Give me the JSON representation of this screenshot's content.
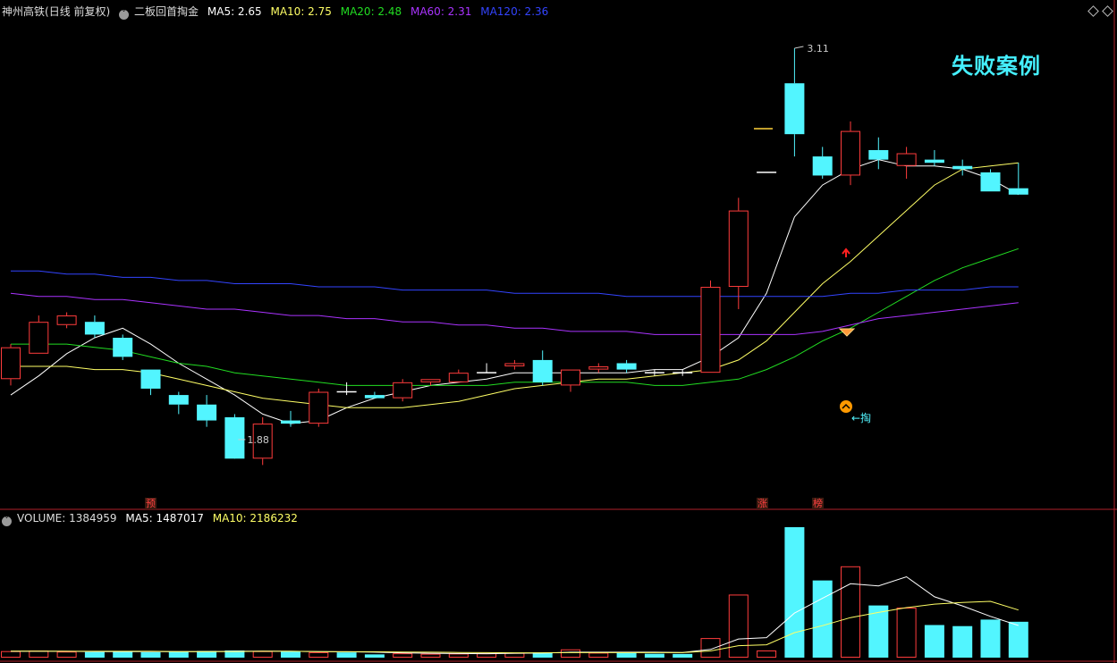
{
  "header": {
    "stock_name": "神州高铁",
    "period": "(日线 前复权)",
    "formula": "二板回首掏金",
    "ma": [
      {
        "label": "MA5: 2.65",
        "color": "#ffffff"
      },
      {
        "label": "MA10: 2.75",
        "color": "#ffff66"
      },
      {
        "label": "MA20: 2.48",
        "color": "#22dd22"
      },
      {
        "label": "MA60: 2.31",
        "color": "#aa33ff"
      },
      {
        "label": "MA120: 2.36",
        "color": "#3344ff"
      }
    ]
  },
  "stamp_text": "失败案例",
  "volume_header": {
    "volume": "VOLUME: 1384959",
    "ma5": "MA5: 1487017",
    "ma10": "MA10: 2186232"
  },
  "annotations": {
    "high_label": "3.11",
    "low_label": "1.88",
    "tao_label": "←掏",
    "tag_yu": "预",
    "tag_zhang": "涨",
    "tag_bang": "榜"
  },
  "colors": {
    "up": "#ff3c3c",
    "down": "#52f5ff",
    "bg": "#000000",
    "grid": "#b0202a"
  },
  "chart_data": {
    "type": "candlestick",
    "title": "神州高铁 (日线 前复权)",
    "price_axis": {
      "ylim": [
        1.7,
        3.2
      ]
    },
    "candles": [
      {
        "o": 2.07,
        "h": 2.18,
        "l": 2.05,
        "c": 2.17
      },
      {
        "o": 2.15,
        "h": 2.27,
        "l": 2.15,
        "c": 2.25
      },
      {
        "o": 2.24,
        "h": 2.28,
        "l": 2.23,
        "c": 2.27
      },
      {
        "o": 2.25,
        "h": 2.27,
        "l": 2.2,
        "c": 2.21
      },
      {
        "o": 2.2,
        "h": 2.21,
        "l": 2.13,
        "c": 2.14
      },
      {
        "o": 2.1,
        "h": 2.1,
        "l": 2.02,
        "c": 2.04
      },
      {
        "o": 2.02,
        "h": 2.03,
        "l": 1.96,
        "c": 1.99
      },
      {
        "o": 1.99,
        "h": 2.02,
        "l": 1.92,
        "c": 1.94
      },
      {
        "o": 1.95,
        "h": 1.96,
        "l": 1.88,
        "c": 1.82
      },
      {
        "o": 1.82,
        "h": 1.95,
        "l": 1.8,
        "c": 1.93
      },
      {
        "o": 1.94,
        "h": 1.97,
        "l": 1.92,
        "c": 1.93
      },
      {
        "o": 1.93,
        "h": 2.04,
        "l": 1.92,
        "c": 2.03
      },
      {
        "o": 2.03,
        "h": 2.06,
        "l": 2.02,
        "c": 2.03
      },
      {
        "o": 2.02,
        "h": 2.03,
        "l": 2.01,
        "c": 2.01
      },
      {
        "o": 2.01,
        "h": 2.07,
        "l": 2.0,
        "c": 2.06
      },
      {
        "o": 2.06,
        "h": 2.07,
        "l": 2.05,
        "c": 2.07
      },
      {
        "o": 2.06,
        "h": 2.1,
        "l": 2.06,
        "c": 2.09
      },
      {
        "o": 2.09,
        "h": 2.12,
        "l": 2.09,
        "c": 2.09
      },
      {
        "o": 2.11,
        "h": 2.13,
        "l": 2.1,
        "c": 2.12
      },
      {
        "o": 2.13,
        "h": 2.16,
        "l": 2.05,
        "c": 2.06
      },
      {
        "o": 2.05,
        "h": 2.1,
        "l": 2.03,
        "c": 2.1
      },
      {
        "o": 2.1,
        "h": 2.12,
        "l": 2.09,
        "c": 2.11
      },
      {
        "o": 2.12,
        "h": 2.13,
        "l": 2.09,
        "c": 2.1
      },
      {
        "o": 2.09,
        "h": 2.1,
        "l": 2.08,
        "c": 2.09
      },
      {
        "o": 2.09,
        "h": 2.1,
        "l": 2.08,
        "c": 2.09
      },
      {
        "o": 2.09,
        "h": 2.38,
        "l": 2.09,
        "c": 2.36
      },
      {
        "o": 2.36,
        "h": 2.64,
        "l": 2.29,
        "c": 2.6
      },
      {
        "o": 2.72,
        "h": 2.72,
        "l": 2.72,
        "c": 2.72
      },
      {
        "o": 3.0,
        "h": 3.11,
        "l": 2.77,
        "c": 2.84
      },
      {
        "o": 2.77,
        "h": 2.8,
        "l": 2.7,
        "c": 2.71
      },
      {
        "o": 2.71,
        "h": 2.88,
        "l": 2.68,
        "c": 2.85
      },
      {
        "o": 2.79,
        "h": 2.83,
        "l": 2.73,
        "c": 2.76
      },
      {
        "o": 2.74,
        "h": 2.8,
        "l": 2.7,
        "c": 2.78
      },
      {
        "o": 2.76,
        "h": 2.79,
        "l": 2.74,
        "c": 2.75
      },
      {
        "o": 2.74,
        "h": 2.76,
        "l": 2.71,
        "c": 2.73
      },
      {
        "o": 2.72,
        "h": 2.73,
        "l": 2.66,
        "c": 2.66
      },
      {
        "o": 2.67,
        "h": 2.75,
        "l": 2.65,
        "c": 2.65
      }
    ],
    "series": [
      {
        "name": "MA5",
        "color": "#ffffff",
        "values": [
          2.02,
          2.08,
          2.15,
          2.2,
          2.23,
          2.18,
          2.12,
          2.07,
          2.02,
          1.96,
          1.93,
          1.94,
          1.98,
          2.01,
          2.03,
          2.05,
          2.06,
          2.07,
          2.09,
          2.09,
          2.09,
          2.09,
          2.09,
          2.1,
          2.1,
          2.14,
          2.2,
          2.34,
          2.58,
          2.68,
          2.73,
          2.76,
          2.74,
          2.74,
          2.73,
          2.7,
          2.65
        ]
      },
      {
        "name": "MA10",
        "color": "#ffff66",
        "values": [
          2.11,
          2.11,
          2.11,
          2.1,
          2.1,
          2.09,
          2.07,
          2.05,
          2.03,
          2.01,
          2.0,
          1.99,
          1.98,
          1.98,
          1.98,
          1.99,
          2.0,
          2.02,
          2.04,
          2.05,
          2.06,
          2.07,
          2.07,
          2.08,
          2.09,
          2.1,
          2.13,
          2.19,
          2.28,
          2.37,
          2.44,
          2.52,
          2.6,
          2.68,
          2.73,
          2.74,
          2.75
        ]
      },
      {
        "name": "MA20",
        "color": "#22dd22",
        "values": [
          2.18,
          2.18,
          2.18,
          2.17,
          2.16,
          2.14,
          2.12,
          2.11,
          2.09,
          2.08,
          2.07,
          2.06,
          2.05,
          2.05,
          2.05,
          2.05,
          2.05,
          2.05,
          2.06,
          2.06,
          2.06,
          2.06,
          2.06,
          2.05,
          2.05,
          2.06,
          2.07,
          2.1,
          2.14,
          2.19,
          2.23,
          2.28,
          2.33,
          2.38,
          2.42,
          2.45,
          2.48
        ]
      },
      {
        "name": "MA60",
        "color": "#aa33ff",
        "values": [
          2.34,
          2.33,
          2.33,
          2.32,
          2.32,
          2.31,
          2.3,
          2.29,
          2.29,
          2.28,
          2.27,
          2.27,
          2.26,
          2.26,
          2.25,
          2.25,
          2.24,
          2.24,
          2.23,
          2.23,
          2.22,
          2.22,
          2.22,
          2.21,
          2.21,
          2.21,
          2.21,
          2.21,
          2.21,
          2.22,
          2.24,
          2.26,
          2.27,
          2.28,
          2.29,
          2.3,
          2.31
        ]
      },
      {
        "name": "MA120",
        "color": "#3344ff",
        "values": [
          2.41,
          2.41,
          2.4,
          2.4,
          2.39,
          2.39,
          2.38,
          2.38,
          2.37,
          2.37,
          2.37,
          2.36,
          2.36,
          2.36,
          2.35,
          2.35,
          2.35,
          2.35,
          2.34,
          2.34,
          2.34,
          2.34,
          2.33,
          2.33,
          2.33,
          2.33,
          2.33,
          2.33,
          2.33,
          2.33,
          2.34,
          2.34,
          2.35,
          2.35,
          2.35,
          2.36,
          2.36
        ]
      }
    ],
    "volume": {
      "ylim": [
        0,
        6000000
      ],
      "values": [
        300000,
        320000,
        280000,
        260000,
        270000,
        250000,
        290000,
        310000,
        330000,
        300000,
        270000,
        250000,
        240000,
        150000,
        200000,
        180000,
        190000,
        200000,
        220000,
        240000,
        380000,
        230000,
        220000,
        180000,
        170000,
        900000,
        2900000,
        330000,
        6000000,
        3550000,
        4200000,
        2400000,
        2300000,
        1500000,
        1450000,
        1750000,
        1650000
      ],
      "up_flags": [
        1,
        1,
        1,
        0,
        0,
        0,
        0,
        0,
        0,
        1,
        0,
        1,
        0,
        0,
        1,
        1,
        1,
        1,
        1,
        0,
        1,
        1,
        0,
        0,
        0,
        1,
        1,
        1,
        0,
        0,
        1,
        0,
        1,
        0,
        0,
        0,
        0
      ],
      "ma5": [
        290000,
        290000,
        290000,
        280000,
        280000,
        280000,
        280000,
        280000,
        290000,
        300000,
        290000,
        280000,
        270000,
        250000,
        220000,
        200000,
        190000,
        180000,
        200000,
        210000,
        250000,
        250000,
        250000,
        250000,
        240000,
        380000,
        860000,
        920000,
        2050000,
        2730000,
        3400000,
        3300000,
        3720000,
        2800000,
        2380000,
        1900000,
        1480000
      ],
      "ma10": [
        300000,
        300000,
        290000,
        290000,
        290000,
        290000,
        280000,
        280000,
        280000,
        290000,
        290000,
        280000,
        270000,
        270000,
        260000,
        250000,
        240000,
        230000,
        220000,
        220000,
        230000,
        230000,
        230000,
        230000,
        230000,
        310000,
        550000,
        590000,
        1150000,
        1470000,
        1840000,
        2080000,
        2300000,
        2460000,
        2540000,
        2590000,
        2190000
      ]
    }
  }
}
